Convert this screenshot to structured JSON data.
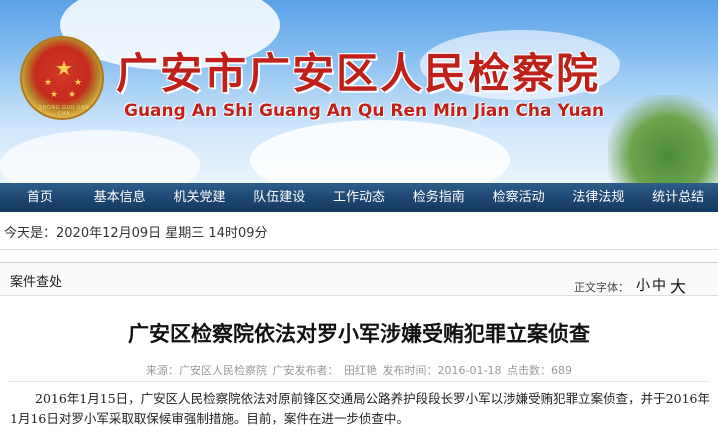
{
  "banner": {
    "title": "广安市广安区人民检察院",
    "subtitle": "Guang An Shi Guang An Qu Ren Min Jian Cha Yuan",
    "emblem_text": "ZHONG GUO JIAN CHA"
  },
  "nav": {
    "items": [
      "首页",
      "基本信息",
      "机关党建",
      "队伍建设",
      "工作动态",
      "检务指南",
      "检察活动",
      "法律法规",
      "统计总结"
    ]
  },
  "datebar": {
    "text": "今天是：2020年12月09日 星期三 14时09分"
  },
  "section": {
    "title": "案件查处",
    "fontsize_label": "正文字体：",
    "fontsize_small": "小",
    "fontsize_medium": "中",
    "fontsize_large": "大"
  },
  "article": {
    "title": "广安区检察院依法对罗小军涉嫌受贿犯罪立案侦查",
    "meta_source": "来源：广安区人民检察院",
    "meta_publisher": "广安发布者：",
    "meta_author": "田红艳",
    "meta_date": "发布时间：2016-01-18",
    "meta_clicks": "点击数：689",
    "body": "2016年1月15日，广安区人民检察院依法对原前锋区交通局公路养护段段长罗小军以涉嫌受贿犯罪立案侦查，并于2016年1月16日对罗小军采取取保候审强制措施。目前，案件在进一步侦查中。"
  },
  "colors": {
    "title_red": "#c0201a",
    "nav_blue": "#1d4670"
  }
}
